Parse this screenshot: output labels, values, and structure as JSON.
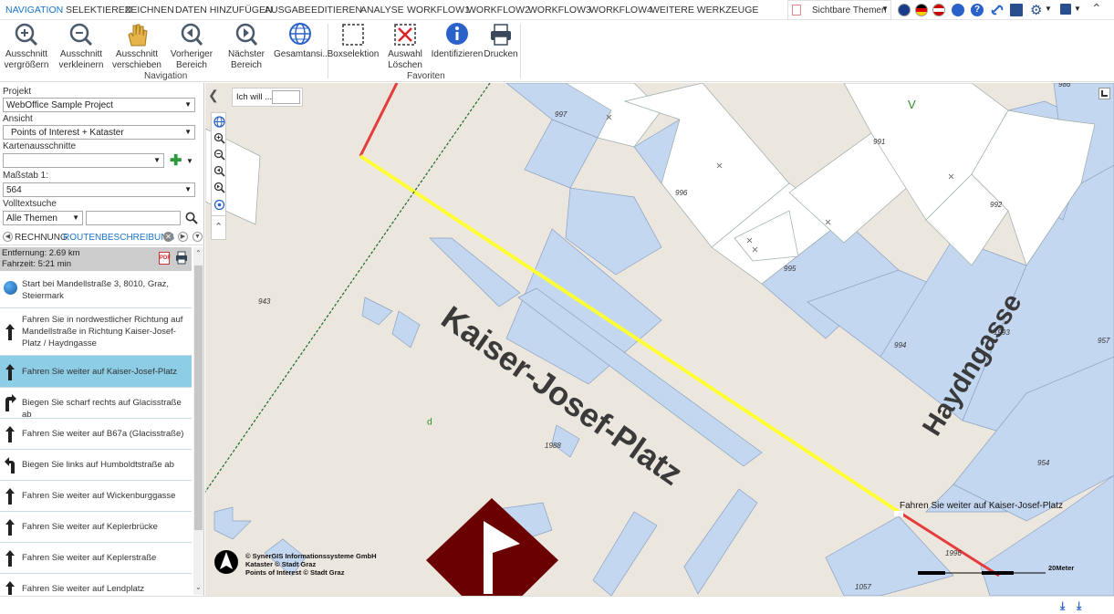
{
  "menubar": {
    "items": [
      "NAVIGATION",
      "SELEKTIEREN",
      "ZEICHNEN",
      "DATEN HINZUFÜGEN",
      "AUSGABE",
      "EDITIEREN",
      "ANALYSE",
      "WORKFLOW1",
      "WORKFLOW2",
      "WORKFLOW3",
      "WORKFLOW4",
      "WEITERE WERKZEUGE"
    ],
    "active_index": 0,
    "themes_label": "Sichtbare Themen",
    "accent": "#1a73c8"
  },
  "ribbon": {
    "buttons": [
      {
        "label1": "Ausschnitt",
        "label2": "vergrößern",
        "icon": "zoom-in-icon"
      },
      {
        "label1": "Ausschnitt",
        "label2": "verkleinern",
        "icon": "zoom-out-icon"
      },
      {
        "label1": "Ausschnitt",
        "label2": "verschieben",
        "icon": "pan-hand-icon"
      },
      {
        "label1": "Vorheriger",
        "label2": "Bereich",
        "icon": "previous-extent-icon"
      },
      {
        "label1": "Nächster",
        "label2": "Bereich",
        "icon": "next-extent-icon"
      },
      {
        "label1": "Gesamtansi...",
        "label2": "",
        "icon": "globe-icon"
      },
      {
        "label1": "Boxselektion",
        "label2": "",
        "icon": "box-select-icon"
      },
      {
        "label1": "Auswahl",
        "label2": "Löschen",
        "icon": "clear-selection-icon"
      },
      {
        "label1": "Identifizieren",
        "label2": "",
        "icon": "info-icon"
      },
      {
        "label1": "Drucken",
        "label2": "",
        "icon": "printer-icon"
      }
    ],
    "group_navigation": "Navigation",
    "group_favoriten": "Favoriten"
  },
  "left": {
    "projekt_label": "Projekt",
    "projekt_value": "WebOffice Sample Project",
    "ansicht_label": "Ansicht",
    "ansicht_value": "Points of Interest + Kataster",
    "kartenausschnitte_label": "Kartenausschnitte",
    "kartenausschnitte_value": "",
    "massstab_label": "Maßstab 1:",
    "massstab_value": "564",
    "volltext_label": "Volltextsuche",
    "volltext_scope": "Alle Themen",
    "volltext_value": "",
    "tab_prev": "RECHNUNG",
    "tab_active": "ROUTENBESCHREIBUNG",
    "distance": "Entfernung: 2.69 km",
    "duration": "Fahrzeit: 5:21 min",
    "route": [
      {
        "text": "Start bei Mandellstraße 3, 8010, Graz, Steiermark",
        "icon": "start-point-icon"
      },
      {
        "text": "Fahren Sie in nordwestlicher Richtung auf Mandellstraße in Richtung Kaiser-Josef-Platz / Haydngasse",
        "icon": "arrow-straight-icon"
      },
      {
        "text": "Fahren Sie weiter auf Kaiser-Josef-Platz",
        "icon": "arrow-straight-icon"
      },
      {
        "text": "Biegen Sie scharf rechts auf Glacisstraße ab",
        "icon": "arrow-sharp-right-icon"
      },
      {
        "text": "Fahren Sie weiter auf B67a (Glacisstraße)",
        "icon": "arrow-straight-icon"
      },
      {
        "text": "Biegen Sie links auf Humboldtstraße ab",
        "icon": "arrow-left-icon"
      },
      {
        "text": "Fahren Sie weiter auf Wickenburggasse",
        "icon": "arrow-straight-icon"
      },
      {
        "text": "Fahren Sie weiter auf Keplerbrücke",
        "icon": "arrow-straight-icon"
      },
      {
        "text": "Fahren Sie weiter auf Keplerstraße",
        "icon": "arrow-straight-icon"
      },
      {
        "text": "Fahren Sie weiter auf Lendplatz",
        "icon": "arrow-straight-icon"
      }
    ],
    "selected_route_index": 2
  },
  "map": {
    "ich_will": "Ich will ...",
    "street1": "Kaiser-Josef-Platz",
    "street2": "Haydngasse",
    "route_callout": "Fahren Sie weiter auf Kaiser-Josef-Platz",
    "parcels": [
      "997",
      "991",
      "996",
      "992",
      "995",
      "943",
      "1993",
      "994",
      "957",
      "1988",
      "954",
      "1996",
      "1057",
      "986"
    ],
    "letter_v": "V",
    "letter_p": "p",
    "copyright1": "© SynerGIS Informationssysteme GmbH",
    "copyright2": "Kataster © Stadt Graz",
    "copyright3": "Points of Interest © Stadt Graz",
    "scale_label": "20Meter",
    "route_color": "#ffff00",
    "parcel_color": "#c4d7f0",
    "poi_color": "#6b0000"
  }
}
